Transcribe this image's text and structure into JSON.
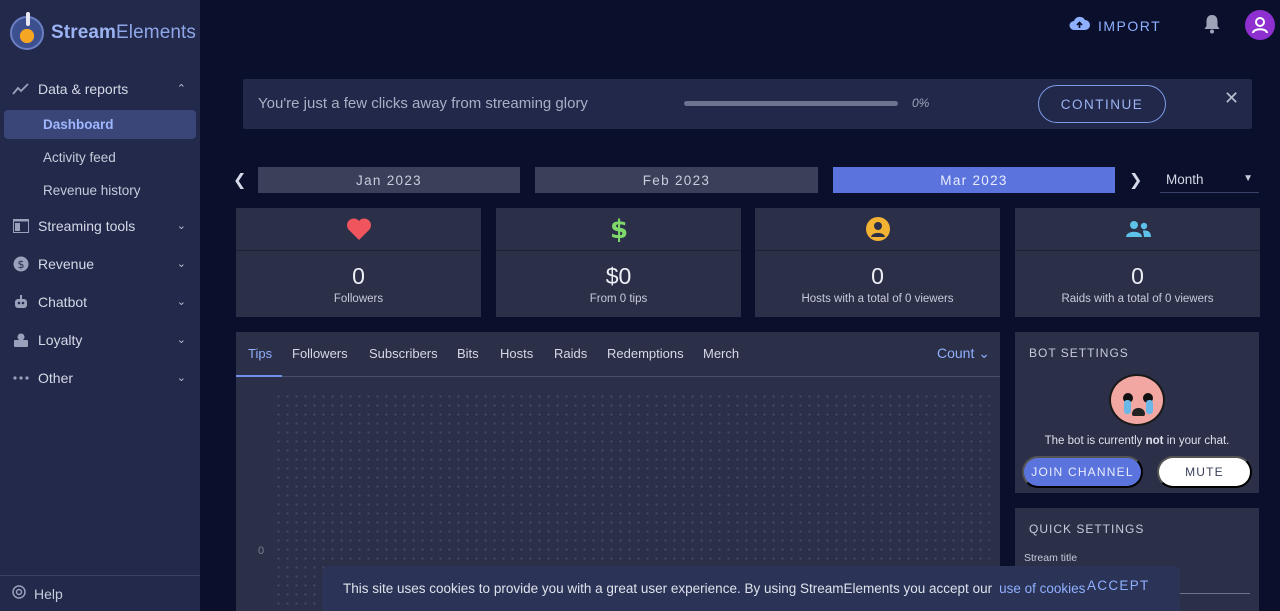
{
  "brand": {
    "name_bold": "Stream",
    "name_rest": "Elements"
  },
  "sidebar": {
    "groups": [
      {
        "label": "Data & reports",
        "icon": "chart-line-icon",
        "expanded": true
      },
      {
        "label": "Streaming tools",
        "icon": "layout-icon"
      },
      {
        "label": "Revenue",
        "icon": "dollar-circle-icon"
      },
      {
        "label": "Chatbot",
        "icon": "robot-icon"
      },
      {
        "label": "Loyalty",
        "icon": "loyalty-icon"
      },
      {
        "label": "Other",
        "icon": "more-horizontal-icon"
      }
    ],
    "data_items": [
      "Dashboard",
      "Activity feed",
      "Revenue history"
    ],
    "help": "Help"
  },
  "header": {
    "import_label": "IMPORT"
  },
  "banner": {
    "text": "You're just a few clicks away from streaming glory",
    "progress": 0,
    "progress_label": "0%",
    "continue_label": "CONTINUE"
  },
  "period": {
    "items": [
      "Jan 2023",
      "Feb 2023",
      "Mar 2023"
    ],
    "active": "Mar 2023",
    "range": "Month"
  },
  "stats": [
    {
      "icon": "heart-icon",
      "color": "#f0555e",
      "value": "0",
      "label": "Followers"
    },
    {
      "icon": "dollar-icon",
      "color": "#7ed86a",
      "value": "$0",
      "label": "From 0 tips"
    },
    {
      "icon": "user-circle-icon",
      "color": "#f2b233",
      "value": "0",
      "label": "Hosts with a total of 0 viewers"
    },
    {
      "icon": "users-icon",
      "color": "#5ec1e8",
      "value": "0",
      "label": "Raids with a total of 0 viewers"
    }
  ],
  "chart": {
    "tabs": [
      "Tips",
      "Followers",
      "Subscribers",
      "Bits",
      "Hosts",
      "Raids",
      "Redemptions",
      "Merch"
    ],
    "active_tab": "Tips",
    "metric": "Count",
    "y_tick": "0"
  },
  "bot": {
    "title": "BOT SETTINGS",
    "status_pre": "The bot is currently ",
    "status_bold": "not",
    "status_post": " in your chat.",
    "join_label": "JOIN CHANNEL",
    "mute_label": "MUTE"
  },
  "quick": {
    "title": "QUICK SETTINGS",
    "stream_title_label": "Stream title"
  },
  "cookie": {
    "text": "This site uses cookies to provide you with a great user experience. By using StreamElements you accept our",
    "link": "use of cookies",
    "accept": "ACCEPT"
  },
  "colors": {
    "accent": "#5b74dd",
    "link": "#8fb0ff",
    "sidebar": "#22294a",
    "card": "#2b2f47"
  }
}
